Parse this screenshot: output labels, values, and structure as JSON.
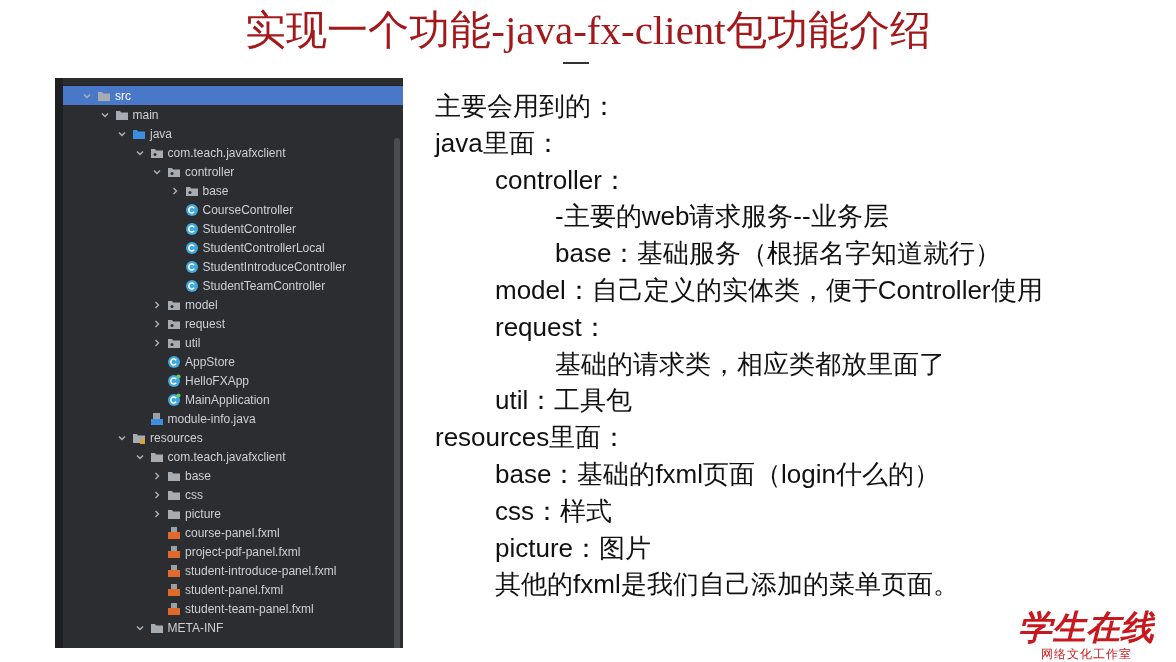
{
  "title": "实现一个功能-java-fx-client包功能介绍",
  "project_tree": [
    {
      "label": "src",
      "kind": "folder",
      "expanded": true,
      "selected": true,
      "children": [
        {
          "label": "main",
          "kind": "folder",
          "expanded": true,
          "selected": false,
          "children": [
            {
              "label": "java",
              "kind": "source-folder",
              "expanded": true,
              "selected": false,
              "children": [
                {
                  "label": "com.teach.javafxclient",
                  "kind": "package",
                  "expanded": true,
                  "selected": false,
                  "children": [
                    {
                      "label": "controller",
                      "kind": "package",
                      "expanded": true,
                      "selected": false,
                      "children": [
                        {
                          "label": "base",
                          "kind": "package",
                          "expanded": false,
                          "selected": false
                        },
                        {
                          "label": "CourseController",
                          "kind": "class",
                          "selected": false
                        },
                        {
                          "label": "StudentController",
                          "kind": "class",
                          "selected": false
                        },
                        {
                          "label": "StudentControllerLocal",
                          "kind": "class",
                          "selected": false
                        },
                        {
                          "label": "StudentIntroduceController",
                          "kind": "class",
                          "selected": false
                        },
                        {
                          "label": "StudentTeamController",
                          "kind": "class",
                          "selected": false
                        }
                      ]
                    },
                    {
                      "label": "model",
                      "kind": "package",
                      "expanded": false,
                      "selected": false
                    },
                    {
                      "label": "request",
                      "kind": "package",
                      "expanded": false,
                      "selected": false
                    },
                    {
                      "label": "util",
                      "kind": "package",
                      "expanded": false,
                      "selected": false
                    },
                    {
                      "label": "AppStore",
                      "kind": "class",
                      "selected": false
                    },
                    {
                      "label": "HelloFXApp",
                      "kind": "app-class",
                      "selected": false
                    },
                    {
                      "label": "MainApplication",
                      "kind": "app-class",
                      "selected": false
                    }
                  ]
                },
                {
                  "label": "module-info.java",
                  "kind": "java-file",
                  "selected": false
                }
              ]
            },
            {
              "label": "resources",
              "kind": "resource-folder",
              "expanded": true,
              "selected": false,
              "children": [
                {
                  "label": "com.teach.javafxclient",
                  "kind": "folder",
                  "expanded": true,
                  "selected": false,
                  "children": [
                    {
                      "label": "base",
                      "kind": "folder",
                      "expanded": false,
                      "selected": false
                    },
                    {
                      "label": "css",
                      "kind": "folder",
                      "expanded": false,
                      "selected": false
                    },
                    {
                      "label": "picture",
                      "kind": "folder",
                      "expanded": false,
                      "selected": false
                    },
                    {
                      "label": "course-panel.fxml",
                      "kind": "fxml",
                      "selected": false
                    },
                    {
                      "label": "project-pdf-panel.fxml",
                      "kind": "fxml",
                      "selected": false
                    },
                    {
                      "label": "student-introduce-panel.fxml",
                      "kind": "fxml",
                      "selected": false
                    },
                    {
                      "label": "student-panel.fxml",
                      "kind": "fxml",
                      "selected": false
                    },
                    {
                      "label": "student-team-panel.fxml",
                      "kind": "fxml",
                      "selected": false
                    }
                  ]
                },
                {
                  "label": "META-INF",
                  "kind": "folder",
                  "expanded": true,
                  "selected": false
                }
              ]
            }
          ]
        }
      ]
    }
  ],
  "notes": [
    {
      "text": "主要会用到的："
    },
    {
      "text": "java里面：",
      "children": [
        {
          "text": "controller：",
          "children": [
            {
              "text": "-主要的web请求服务--业务层"
            },
            {
              "text": "base：基础服务（根据名字知道就行）"
            }
          ]
        },
        {
          "text": "model：自己定义的实体类，便于Controller使用"
        },
        {
          "text": "request：",
          "children": [
            {
              "text": "基础的请求类，相应类都放里面了"
            }
          ]
        },
        {
          "text": "util：工具包"
        }
      ]
    },
    {
      "text": "resources里面：",
      "children": [
        {
          "text": "base：基础的fxml页面（login什么的）"
        },
        {
          "text": "css：样式"
        },
        {
          "text": "picture：图片"
        },
        {
          "text": "其他的fxml是我们自己添加的菜单页面。"
        }
      ]
    }
  ],
  "logo": {
    "name": "学生在线",
    "subtitle": "网络文化工作室"
  }
}
